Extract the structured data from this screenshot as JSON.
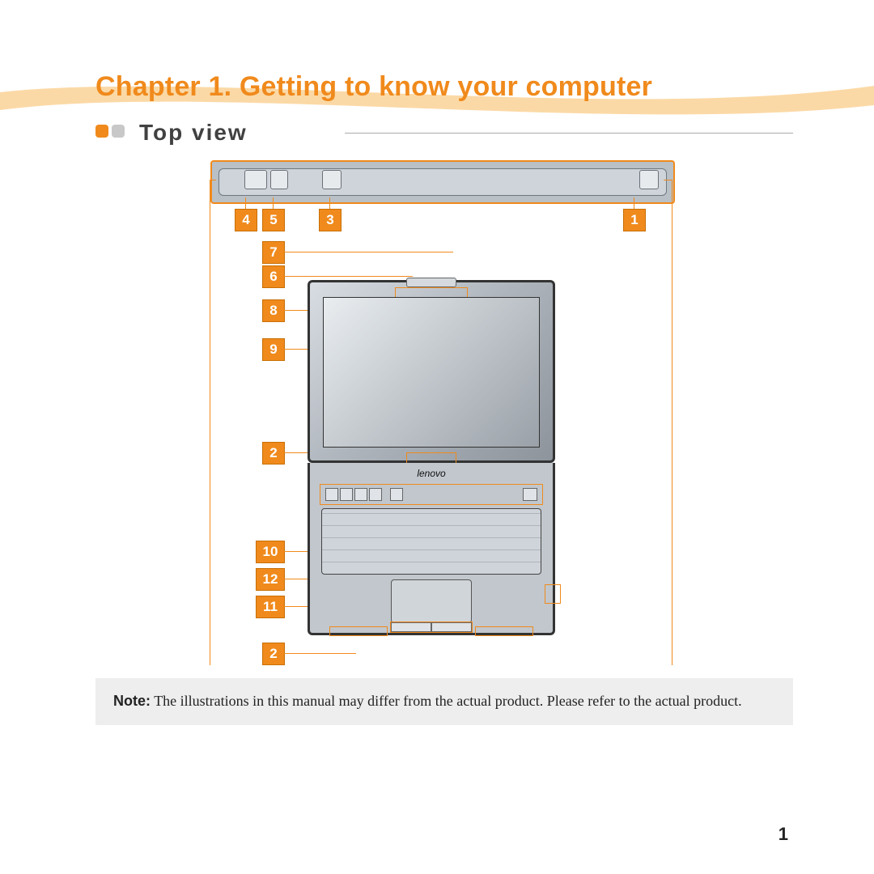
{
  "chapter_title": "Chapter 1. Getting to know your computer",
  "section_title": "Top view",
  "brand_label": "lenovo",
  "callouts": {
    "c1": "1",
    "c2": "2",
    "c3": "3",
    "c4": "4",
    "c5": "5",
    "c6": "6",
    "c7": "7",
    "c8": "8",
    "c9": "9",
    "c10": "10",
    "c11": "11",
    "c12": "12",
    "c2b": "2"
  },
  "note": {
    "label": "Note:",
    "text": "The illustrations in this manual may differ from the actual product. Please refer to the actual product."
  },
  "page_number": "1"
}
